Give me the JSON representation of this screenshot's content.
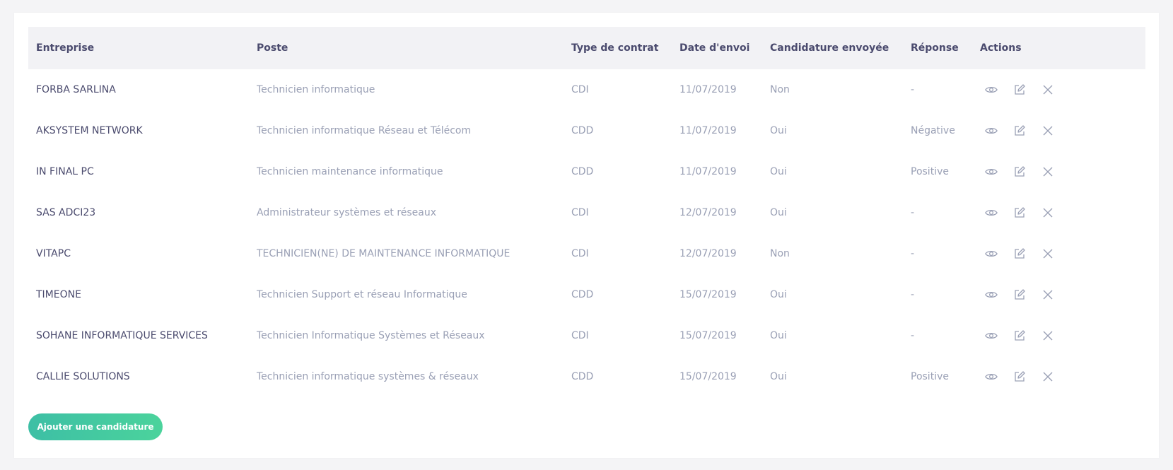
{
  "table": {
    "headers": [
      "Entreprise",
      "Poste",
      "Type de contrat",
      "Date d'envoi",
      "Candidature envoyée",
      "Réponse",
      "Actions"
    ],
    "rows": [
      {
        "entreprise": "FORBA SARLINA",
        "poste": "Technicien informatique",
        "contrat": "CDI",
        "date": "11/07/2019",
        "envoyee": "Non",
        "reponse": "-"
      },
      {
        "entreprise": "AKSYSTEM NETWORK",
        "poste": "Technicien informatique Réseau et Télécom",
        "contrat": "CDD",
        "date": "11/07/2019",
        "envoyee": "Oui",
        "reponse": "Négative"
      },
      {
        "entreprise": "IN FINAL PC",
        "poste": "Technicien maintenance informatique",
        "contrat": "CDD",
        "date": "11/07/2019",
        "envoyee": "Oui",
        "reponse": "Positive"
      },
      {
        "entreprise": "SAS ADCI23",
        "poste": "Administrateur systèmes et réseaux",
        "contrat": "CDI",
        "date": "12/07/2019",
        "envoyee": "Oui",
        "reponse": "-"
      },
      {
        "entreprise": "VITAPC",
        "poste": "TECHNICIEN(NE) DE MAINTENANCE INFORMATIQUE",
        "contrat": "CDI",
        "date": "12/07/2019",
        "envoyee": "Non",
        "reponse": "-"
      },
      {
        "entreprise": "TIMEONE",
        "poste": "Technicien Support et réseau Informatique",
        "contrat": "CDD",
        "date": "15/07/2019",
        "envoyee": "Oui",
        "reponse": "-"
      },
      {
        "entreprise": "SOHANE INFORMATIQUE SERVICES",
        "poste": "Technicien Informatique Systèmes et Réseaux",
        "contrat": "CDI",
        "date": "15/07/2019",
        "envoyee": "Oui",
        "reponse": "-"
      },
      {
        "entreprise": "CALLIE SOLUTIONS",
        "poste": "Technicien informatique systèmes & réseaux",
        "contrat": "CDD",
        "date": "15/07/2019",
        "envoyee": "Oui",
        "reponse": "Positive"
      }
    ],
    "row_actions": [
      "eye-icon",
      "edit-icon",
      "close-icon"
    ]
  },
  "add_button": {
    "label": "Ajouter une candidature"
  },
  "colors": {
    "background": "#f4f4f6",
    "header_bg": "#f2f2f5",
    "header_text": "#4b4b6e",
    "cell_text": "#9aa0b5",
    "accent": "#45c9a0"
  }
}
